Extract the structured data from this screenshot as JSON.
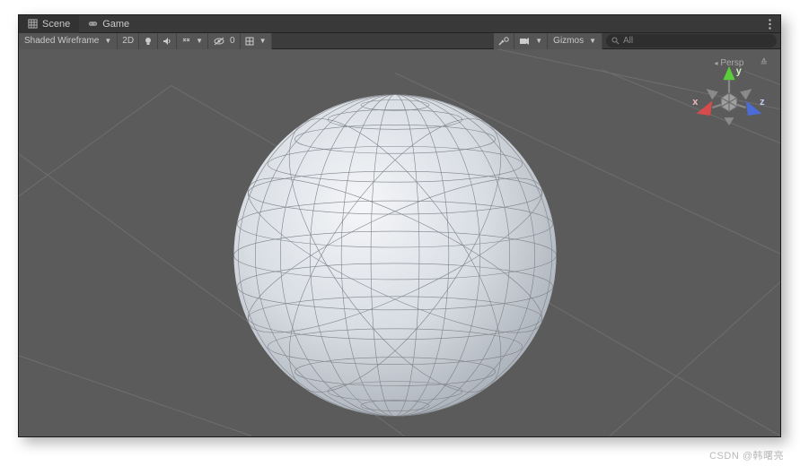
{
  "tabs": {
    "scene": "Scene",
    "game": "Game"
  },
  "toolbar": {
    "shading": "Shaded Wireframe",
    "mode2d": "2D",
    "gizmos": "Gizmos",
    "search_placeholder": "All"
  },
  "gizmo": {
    "x": "x",
    "y": "y",
    "z": "z",
    "projection": "Persp",
    "lock": "≙"
  },
  "icons": {
    "grid": "grid-icon",
    "gamepad": "gamepad-icon",
    "bulb": "lightbulb-icon",
    "audio": "audio-icon",
    "fx": "fx-icon",
    "eye": "visibility-icon",
    "camera": "camera-icon",
    "snap": "grid-snap-icon",
    "tools": "tools-icon",
    "search": "search-icon"
  },
  "watermark": "CSDN @韩曙亮"
}
